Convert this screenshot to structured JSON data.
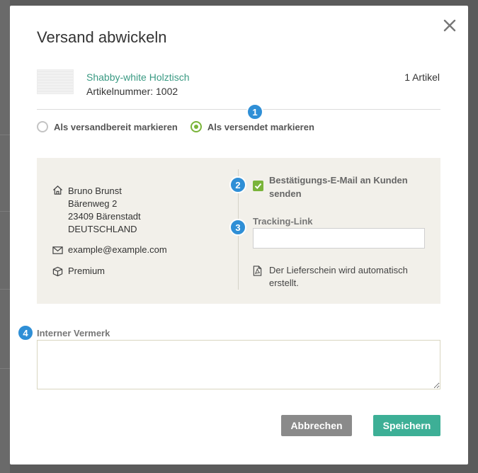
{
  "background": {
    "color": "#5b5b5b"
  },
  "modal": {
    "title": "Versand abwickeln",
    "close_icon": "close-icon"
  },
  "product": {
    "name": "Shabby-white Holztisch",
    "sku": "Artikelnummer: 1002",
    "quantity": "1 Artikel"
  },
  "shipping_status": {
    "options": [
      {
        "label": "Als versandbereit markieren",
        "checked": false
      },
      {
        "label": "Als versendet markieren",
        "checked": true
      }
    ]
  },
  "customer": {
    "name": "Bruno Brunst",
    "street": "Bärenweg 2",
    "city": "23409 Bärenstadt",
    "country": "DEUTSCHLAND",
    "email": "example@example.com",
    "shipping_method": "Premium"
  },
  "confirmation": {
    "label": "Bestätigungs-E-Mail an Kunden senden",
    "checked": true
  },
  "tracking": {
    "label": "Tracking-Link",
    "value": ""
  },
  "delivery_note": {
    "text": "Der Lieferschein wird automatisch erstellt."
  },
  "internal_note": {
    "label": "Interner Vermerk",
    "value": ""
  },
  "actions": {
    "cancel_label": "Abbrechen",
    "save_label": "Speichern"
  },
  "badges": [
    "1",
    "2",
    "3",
    "4"
  ],
  "colors": {
    "accent_green": "#7ab43a",
    "link_teal": "#3a9a83",
    "save_button": "#3daf96",
    "cancel_button": "#8a8a8a",
    "badge_blue": "#2f8fd6",
    "panel_bg": "#f2f0ea"
  }
}
